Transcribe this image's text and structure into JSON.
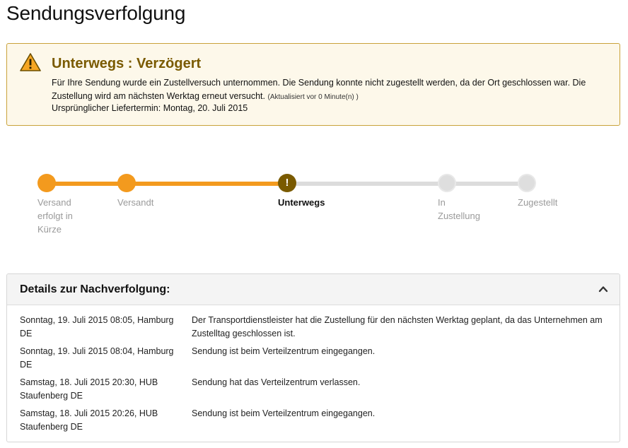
{
  "page": {
    "title": "Sendungsverfolgung"
  },
  "alert": {
    "icon": "warning-icon",
    "title": "Unterwegs : Verzögert",
    "message": "Für Ihre Sendung wurde ein Zustellversuch unternommen. Die Sendung konnte nicht zugestellt werden, da der Ort geschlossen war. Die Zustellung wird am nächsten Werktag erneut versucht.",
    "updated": "(Aktualisiert vor 0 Minute(n) )",
    "original_date": "Ursprünglicher Liefertermin: Montag, 20. Juli 2015"
  },
  "progress": {
    "current_marker": "!",
    "steps": [
      {
        "label": "Versand erfolgt in Kürze",
        "state": "done"
      },
      {
        "label": "Versandt",
        "state": "done"
      },
      {
        "label": "Unterwegs",
        "state": "current"
      },
      {
        "label": "In Zustellung",
        "state": "todo"
      },
      {
        "label": "Zugestellt",
        "state": "todo"
      }
    ]
  },
  "details": {
    "title": "Details zur Nachverfolgung:",
    "toggle_icon": "chevron-up-icon",
    "events": [
      {
        "when": "Sonntag, 19. Juli 2015 08:05, Hamburg DE",
        "what": "Der Transportdienstleister hat die Zustellung für den nächsten Werktag geplant, da das Unternehmen am Zustelltag geschlossen ist."
      },
      {
        "when": "Sonntag, 19. Juli 2015 08:04, Hamburg DE",
        "what": "Sendung ist beim Verteilzentrum eingegangen."
      },
      {
        "when": "Samstag, 18. Juli 2015 20:30, HUB Staufenberg DE",
        "what": "Sendung hat das Verteilzentrum verlassen."
      },
      {
        "when": "Samstag, 18. Juli 2015 20:26, HUB Staufenberg DE",
        "what": "Sendung ist beim Verteilzentrum eingegangen."
      }
    ]
  },
  "colors": {
    "accent_orange": "#f39a1e",
    "alert_brown": "#7a5a00",
    "alert_border": "#c9a23a",
    "pending_gray": "#dedede"
  }
}
